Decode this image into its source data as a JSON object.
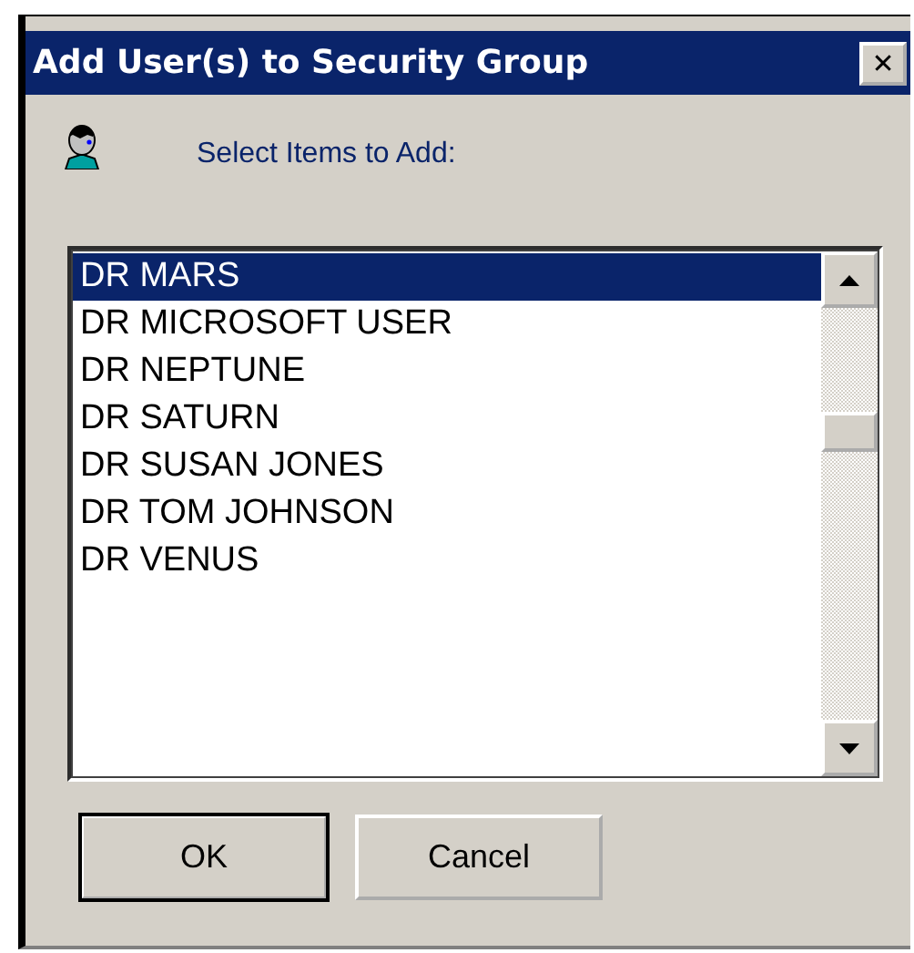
{
  "window": {
    "title": "Add User(s) to Security Group",
    "close_glyph": "✕"
  },
  "prompt": "Select Items to Add:",
  "list": {
    "items": [
      {
        "label": "DR MARS",
        "selected": true
      },
      {
        "label": "DR MICROSOFT USER",
        "selected": false
      },
      {
        "label": "DR NEPTUNE",
        "selected": false
      },
      {
        "label": "DR SATURN",
        "selected": false
      },
      {
        "label": "DR SUSAN JONES",
        "selected": false
      },
      {
        "label": "DR TOM JOHNSON",
        "selected": false
      },
      {
        "label": "DR VENUS",
        "selected": false
      }
    ]
  },
  "buttons": [
    {
      "label": "OK",
      "default": true
    },
    {
      "label": "Cancel",
      "default": false
    }
  ]
}
